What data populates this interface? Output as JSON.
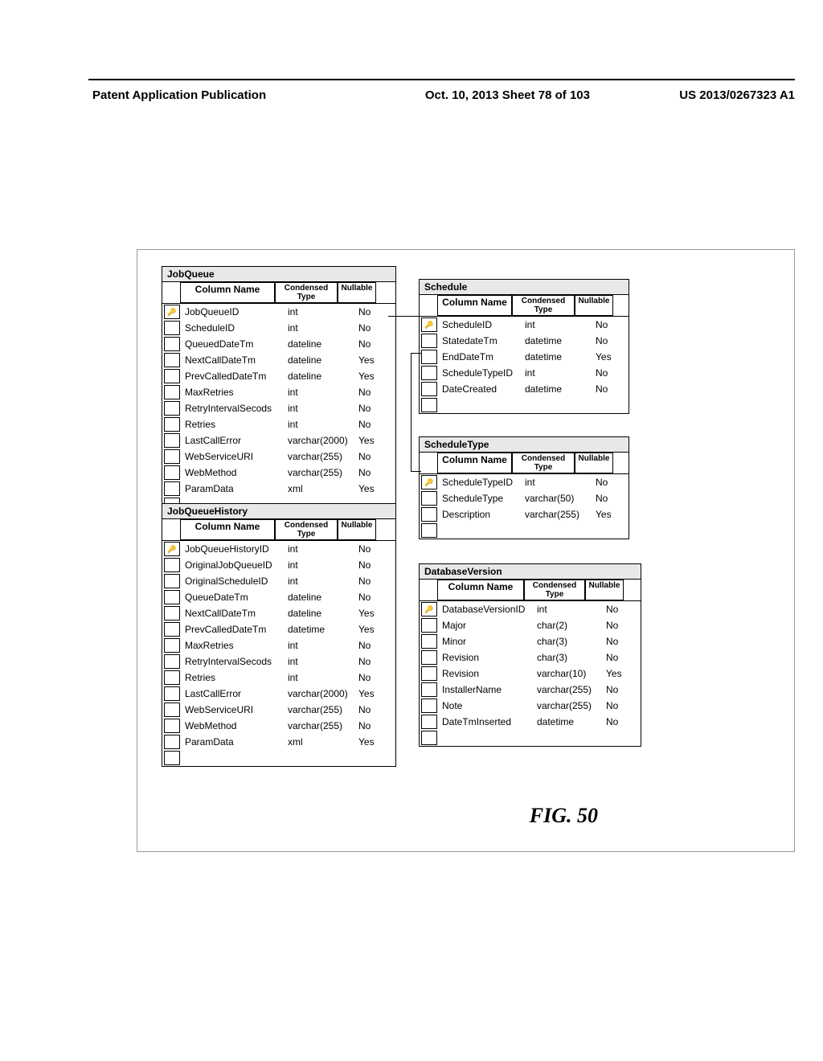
{
  "header": {
    "left": "Patent Application Publication",
    "date_sheet": "Oct. 10, 2013  Sheet 78 of 103",
    "pub_number": "US 2013/0267323 A1"
  },
  "figure_label": "FIG. 50",
  "tables": {
    "jobqueue": {
      "title": "JobQueue",
      "headers": [
        "Column Name",
        "Condensed Type",
        "Nullable"
      ],
      "rows": [
        {
          "key": true,
          "name": "JobQueueID",
          "type": "int",
          "nullable": "No"
        },
        {
          "key": false,
          "name": "ScheduleID",
          "type": "int",
          "nullable": "No"
        },
        {
          "key": false,
          "name": "QueuedDateTm",
          "type": "dateline",
          "nullable": "No"
        },
        {
          "key": false,
          "name": "NextCallDateTm",
          "type": "dateline",
          "nullable": "Yes"
        },
        {
          "key": false,
          "name": "PrevCalledDateTm",
          "type": "dateline",
          "nullable": "Yes"
        },
        {
          "key": false,
          "name": "MaxRetries",
          "type": "int",
          "nullable": "No"
        },
        {
          "key": false,
          "name": "RetryIntervalSecods",
          "type": "int",
          "nullable": "No"
        },
        {
          "key": false,
          "name": "Retries",
          "type": "int",
          "nullable": "No"
        },
        {
          "key": false,
          "name": "LastCallError",
          "type": "varchar(2000)",
          "nullable": "Yes"
        },
        {
          "key": false,
          "name": "WebServiceURI",
          "type": "varchar(255)",
          "nullable": "No"
        },
        {
          "key": false,
          "name": "WebMethod",
          "type": "varchar(255)",
          "nullable": "No"
        },
        {
          "key": false,
          "name": "ParamData",
          "type": "xml",
          "nullable": "Yes"
        }
      ]
    },
    "jobqueuehistory": {
      "title": "JobQueueHistory",
      "headers": [
        "Column Name",
        "Condensed Type",
        "Nullable"
      ],
      "rows": [
        {
          "key": true,
          "name": "JobQueueHistoryID",
          "type": "int",
          "nullable": "No"
        },
        {
          "key": false,
          "name": "OriginalJobQueueID",
          "type": "int",
          "nullable": "No"
        },
        {
          "key": false,
          "name": "OriginalScheduleID",
          "type": "int",
          "nullable": "No"
        },
        {
          "key": false,
          "name": "QueueDateTm",
          "type": "dateline",
          "nullable": "No"
        },
        {
          "key": false,
          "name": "NextCallDateTm",
          "type": "dateline",
          "nullable": "Yes"
        },
        {
          "key": false,
          "name": "PrevCalledDateTm",
          "type": "datetime",
          "nullable": "Yes"
        },
        {
          "key": false,
          "name": "MaxRetries",
          "type": "int",
          "nullable": "No"
        },
        {
          "key": false,
          "name": "RetryIntervalSecods",
          "type": "int",
          "nullable": "No"
        },
        {
          "key": false,
          "name": "Retries",
          "type": "int",
          "nullable": "No"
        },
        {
          "key": false,
          "name": "LastCallError",
          "type": "varchar(2000)",
          "nullable": "Yes"
        },
        {
          "key": false,
          "name": "WebServiceURI",
          "type": "varchar(255)",
          "nullable": "No"
        },
        {
          "key": false,
          "name": "WebMethod",
          "type": "varchar(255)",
          "nullable": "No"
        },
        {
          "key": false,
          "name": "ParamData",
          "type": "xml",
          "nullable": "Yes"
        }
      ]
    },
    "schedule": {
      "title": "Schedule",
      "headers": [
        "Column Name",
        "Condensed Type",
        "Nullable"
      ],
      "rows": [
        {
          "key": true,
          "name": "ScheduleID",
          "type": "int",
          "nullable": "No"
        },
        {
          "key": false,
          "name": "StatedateTm",
          "type": "datetime",
          "nullable": "No"
        },
        {
          "key": false,
          "name": "EndDateTm",
          "type": "datetime",
          "nullable": "Yes"
        },
        {
          "key": false,
          "name": "ScheduleTypeID",
          "type": "int",
          "nullable": "No"
        },
        {
          "key": false,
          "name": "DateCreated",
          "type": "datetime",
          "nullable": "No"
        }
      ]
    },
    "scheduletype": {
      "title": "ScheduleType",
      "headers": [
        "Column Name",
        "Condensed Type",
        "Nullable"
      ],
      "rows": [
        {
          "key": true,
          "name": "ScheduleTypeID",
          "type": "int",
          "nullable": "No"
        },
        {
          "key": false,
          "name": "ScheduleType",
          "type": "varchar(50)",
          "nullable": "No"
        },
        {
          "key": false,
          "name": "Description",
          "type": "varchar(255)",
          "nullable": "Yes"
        }
      ]
    },
    "databaseversion": {
      "title": "DatabaseVersion",
      "headers": [
        "Column Name",
        "Condensed Type",
        "Nullable"
      ],
      "rows": [
        {
          "key": true,
          "name": "DatabaseVersionID",
          "type": "int",
          "nullable": "No"
        },
        {
          "key": false,
          "name": "Major",
          "type": "char(2)",
          "nullable": "No"
        },
        {
          "key": false,
          "name": "Minor",
          "type": "char(3)",
          "nullable": "No"
        },
        {
          "key": false,
          "name": "Revision",
          "type": "char(3)",
          "nullable": "No"
        },
        {
          "key": false,
          "name": "Revision",
          "type": "varchar(10)",
          "nullable": "Yes"
        },
        {
          "key": false,
          "name": "InstallerName",
          "type": "varchar(255)",
          "nullable": "No"
        },
        {
          "key": false,
          "name": "Note",
          "type": "varchar(255)",
          "nullable": "No"
        },
        {
          "key": false,
          "name": "DateTmInserted",
          "type": "datetime",
          "nullable": "No"
        }
      ]
    }
  },
  "col_widths": {
    "jobqueue": {
      "name": 120,
      "type": 80,
      "null": 50
    },
    "jobqueuehistory": {
      "name": 120,
      "type": 80,
      "null": 50
    },
    "schedule": {
      "name": 95,
      "type": 80,
      "null": 50
    },
    "scheduletype": {
      "name": 95,
      "type": 80,
      "null": 50
    },
    "databaseversion": {
      "name": 110,
      "type": 78,
      "null": 50
    }
  }
}
